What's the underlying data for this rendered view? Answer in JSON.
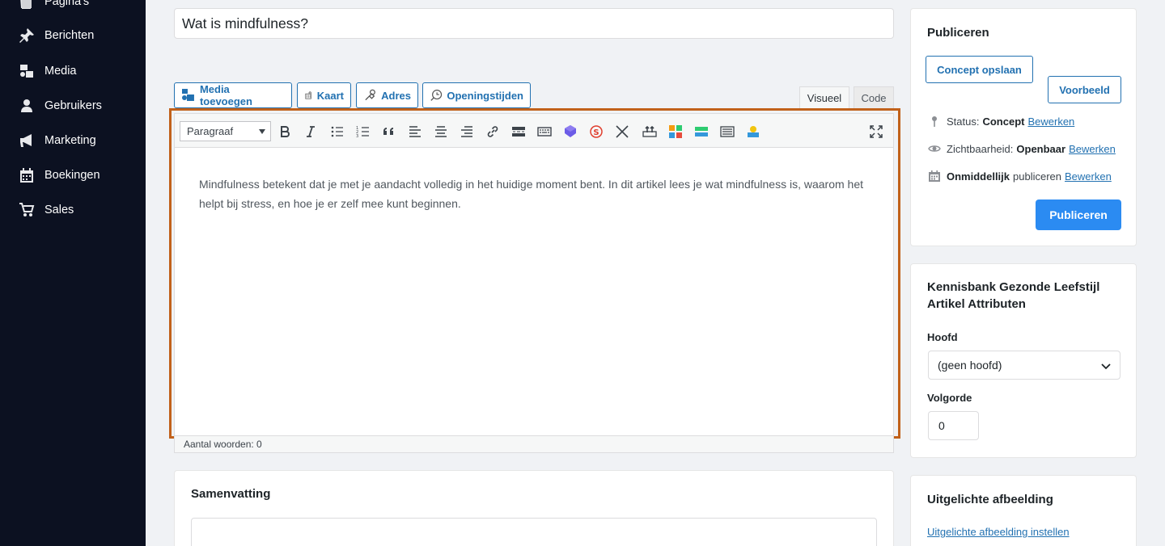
{
  "sidebar": {
    "items": [
      {
        "label": "Pagina's",
        "icon": "pages-icon"
      },
      {
        "label": "Berichten",
        "icon": "pin-icon"
      },
      {
        "label": "Media",
        "icon": "media-icon"
      },
      {
        "label": "Gebruikers",
        "icon": "user-icon"
      },
      {
        "label": "Marketing",
        "icon": "megaphone-icon"
      },
      {
        "label": "Boekingen",
        "icon": "calendar-icon"
      },
      {
        "label": "Sales",
        "icon": "cart-icon"
      }
    ]
  },
  "post": {
    "title": "Wat is mindfulness?"
  },
  "media_buttons": [
    {
      "label": "Media toevoegen",
      "icon": "add-media-icon"
    },
    {
      "label": "Kaart",
      "icon": "map-icon"
    },
    {
      "label": "Adres",
      "icon": "address-icon"
    },
    {
      "label": "Openingstijden",
      "icon": "clock-icon"
    }
  ],
  "editor_tabs": {
    "visual": "Visueel",
    "code": "Code"
  },
  "editor": {
    "format_select": "Paragraaf",
    "content": "Mindfulness betekent dat je met je aandacht volledig in het huidige moment bent. In dit artikel lees je wat mindfulness is, waarom het helpt bij stress, en hoe je er zelf mee kunt beginnen.",
    "word_count": "Aantal woorden: 0"
  },
  "summary": {
    "title": "Samenvatting"
  },
  "publish": {
    "title": "Publiceren",
    "save_draft": "Concept opslaan",
    "preview": "Voorbeeld",
    "status_label": "Status:",
    "status_value": "Concept",
    "visibility_label": "Zichtbaarheid:",
    "visibility_value": "Openbaar",
    "schedule_value": "Onmiddellijk",
    "schedule_label": "publiceren",
    "edit_link": "Bewerken",
    "publish_button": "Publiceren"
  },
  "attributes": {
    "title": "Kennisbank Gezonde Leefstijl Artikel Attributen",
    "parent_label": "Hoofd",
    "parent_value": "(geen hoofd)",
    "order_label": "Volgorde",
    "order_value": "0"
  },
  "featured_image": {
    "title": "Uitgelichte afbeelding",
    "set_link": "Uitgelichte afbeelding instellen"
  },
  "colors": {
    "sidebar_bg": "#0c1121",
    "accent": "#2271b1",
    "primary_button": "#2b8bf2",
    "highlight_border": "#c1611a"
  }
}
